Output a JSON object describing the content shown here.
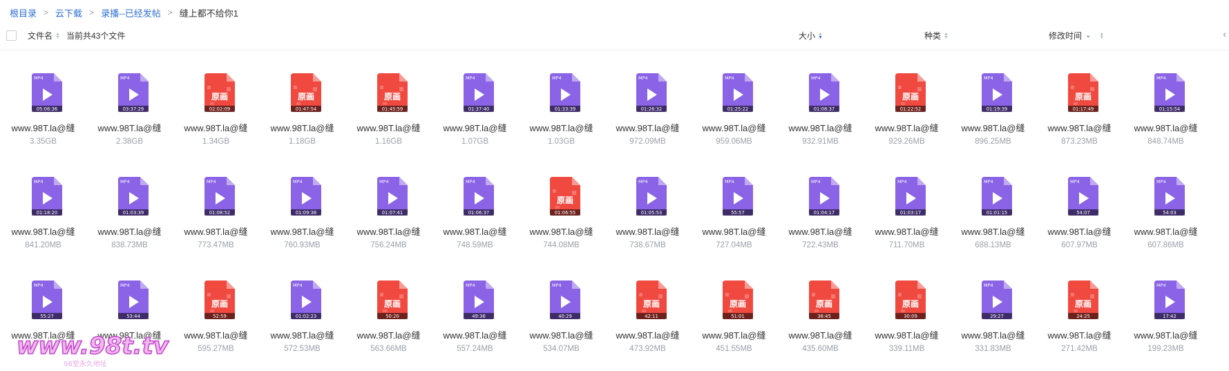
{
  "breadcrumb": {
    "items": [
      "根目录",
      "云下载",
      "录播--已经发帖"
    ],
    "current": "缝上都不给你1",
    "separator": ">"
  },
  "header": {
    "name_label": "文件名",
    "count_label": "当前共43个文件",
    "size_label": "大小",
    "type_label": "种类",
    "mtime_label": "修改时间"
  },
  "colors": {
    "mp4_icon": "#8a63e6",
    "yuanhua_icon": "#f04a40",
    "link": "#2f6fd6"
  },
  "files": [
    {
      "name": "www.98T.la@缝",
      "size": "3.35GB",
      "kind": "mp4",
      "duration": "05:06:36"
    },
    {
      "name": "www.98T.la@缝",
      "size": "2.38GB",
      "kind": "mp4",
      "duration": "03:37:29"
    },
    {
      "name": "www.98T.la@缝",
      "size": "1.34GB",
      "kind": "yuanhua",
      "duration": "02:02:09"
    },
    {
      "name": "www.98T.la@缝",
      "size": "1.18GB",
      "kind": "yuanhua",
      "duration": "01:47:54"
    },
    {
      "name": "www.98T.la@缝",
      "size": "1.16GB",
      "kind": "yuanhua",
      "duration": "01:45:59"
    },
    {
      "name": "www.98T.la@缝",
      "size": "1.07GB",
      "kind": "mp4",
      "duration": "01:37:40"
    },
    {
      "name": "www.98T.la@缝",
      "size": "1.03GB",
      "kind": "mp4",
      "duration": "01:33:39"
    },
    {
      "name": "www.98T.la@缝",
      "size": "972.09MB",
      "kind": "mp4",
      "duration": "01:26:32"
    },
    {
      "name": "www.98T.la@缝",
      "size": "959.06MB",
      "kind": "mp4",
      "duration": "01:25:22"
    },
    {
      "name": "www.98T.la@缝",
      "size": "932.91MB",
      "kind": "mp4",
      "duration": "01:08:37"
    },
    {
      "name": "www.98T.la@缝",
      "size": "929.26MB",
      "kind": "yuanhua",
      "duration": "01:22:52"
    },
    {
      "name": "www.98T.la@缝",
      "size": "896.25MB",
      "kind": "mp4",
      "duration": "01:19:39"
    },
    {
      "name": "www.98T.la@缝",
      "size": "873.23MB",
      "kind": "yuanhua",
      "duration": "01:17:49"
    },
    {
      "name": "www.98T.la@缝",
      "size": "848.74MB",
      "kind": "mp4",
      "duration": "01:15:54"
    },
    {
      "name": "www.98T.la@缝",
      "size": "841.20MB",
      "kind": "mp4",
      "duration": "01:18:20"
    },
    {
      "name": "www.98T.la@缝",
      "size": "838.73MB",
      "kind": "mp4",
      "duration": "01:03:39"
    },
    {
      "name": "www.98T.la@缝",
      "size": "773.47MB",
      "kind": "mp4",
      "duration": "01:08:52"
    },
    {
      "name": "www.98T.la@缝",
      "size": "760.93MB",
      "kind": "mp4",
      "duration": "01:09:38"
    },
    {
      "name": "www.98T.la@缝",
      "size": "756.24MB",
      "kind": "mp4",
      "duration": "01:07:41"
    },
    {
      "name": "www.98T.la@缝",
      "size": "748.59MB",
      "kind": "mp4",
      "duration": "01:06:37"
    },
    {
      "name": "www.98T.la@缝",
      "size": "744.08MB",
      "kind": "yuanhua",
      "duration": "01:06:55"
    },
    {
      "name": "www.98T.la@缝",
      "size": "738.67MB",
      "kind": "mp4",
      "duration": "01:05:53"
    },
    {
      "name": "www.98T.la@缝",
      "size": "727.04MB",
      "kind": "mp4",
      "duration": "55:57"
    },
    {
      "name": "www.98T.la@缝",
      "size": "722.43MB",
      "kind": "mp4",
      "duration": "01:04:17"
    },
    {
      "name": "www.98T.la@缝",
      "size": "711.70MB",
      "kind": "mp4",
      "duration": "01:03:17"
    },
    {
      "name": "www.98T.la@缝",
      "size": "688.13MB",
      "kind": "mp4",
      "duration": "01:01:15"
    },
    {
      "name": "www.98T.la@缝",
      "size": "607.97MB",
      "kind": "mp4",
      "duration": "54:07"
    },
    {
      "name": "www.98T.la@缝",
      "size": "607.86MB",
      "kind": "mp4",
      "duration": "54:03"
    },
    {
      "name": "www.98T.la@缝",
      "size": "",
      "kind": "mp4",
      "duration": "55:27"
    },
    {
      "name": "www.98T.la@缝",
      "size": "",
      "kind": "mp4",
      "duration": "53:44"
    },
    {
      "name": "www.98T.la@缝",
      "size": "595.27MB",
      "kind": "yuanhua",
      "duration": "52:59"
    },
    {
      "name": "www.98T.la@缝",
      "size": "572.53MB",
      "kind": "mp4",
      "duration": "01:02:23"
    },
    {
      "name": "www.98T.la@缝",
      "size": "563.66MB",
      "kind": "yuanhua",
      "duration": "50:20"
    },
    {
      "name": "www.98T.la@缝",
      "size": "557.24MB",
      "kind": "mp4",
      "duration": "49:36"
    },
    {
      "name": "www.98T.la@缝",
      "size": "534.07MB",
      "kind": "mp4",
      "duration": "40:29"
    },
    {
      "name": "www.98T.la@缝",
      "size": "473.92MB",
      "kind": "yuanhua",
      "duration": "42:11"
    },
    {
      "name": "www.98T.la@缝",
      "size": "451.55MB",
      "kind": "yuanhua",
      "duration": "51:01"
    },
    {
      "name": "www.98T.la@缝",
      "size": "435.60MB",
      "kind": "yuanhua",
      "duration": "38:45"
    },
    {
      "name": "www.98T.la@缝",
      "size": "339.11MB",
      "kind": "yuanhua",
      "duration": "30:09"
    },
    {
      "name": "www.98T.la@缝",
      "size": "331.83MB",
      "kind": "mp4",
      "duration": "29:27"
    },
    {
      "name": "www.98T.la@缝",
      "size": "271.42MB",
      "kind": "yuanhua",
      "duration": "24:25"
    },
    {
      "name": "www.98T.la@缝",
      "size": "199.23MB",
      "kind": "mp4",
      "duration": "17:42"
    }
  ],
  "icon_labels": {
    "mp4": "MP4",
    "yuanhua": "原画"
  },
  "watermark": {
    "text": "www.98t.tv",
    "subtext": "98堂永久地址"
  }
}
